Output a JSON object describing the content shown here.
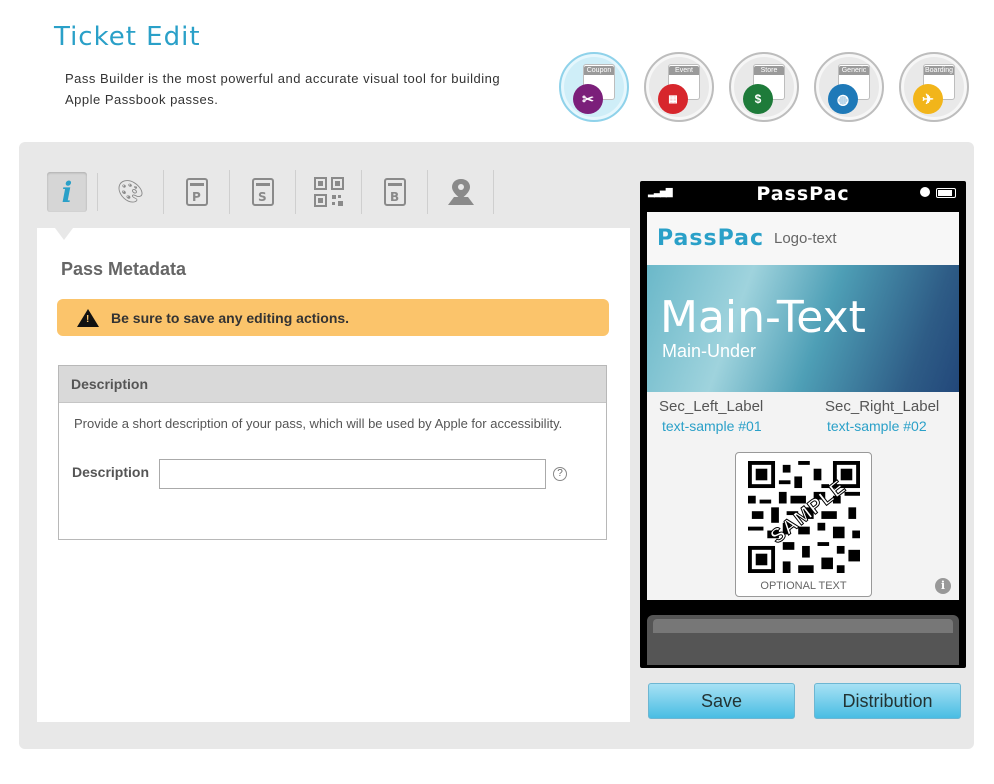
{
  "page": {
    "title": "Ticket Edit",
    "subtitle": "Pass Builder is the most powerful and accurate visual tool for building Apple Passbook passes."
  },
  "pass_types": [
    {
      "label": "Coupon",
      "icon": "scissors-icon",
      "color": "#7b1f7a",
      "active": true
    },
    {
      "label": "Event",
      "icon": "calendar-icon",
      "color": "#d7262c",
      "active": false
    },
    {
      "label": "Store",
      "icon": "dollar-card-icon",
      "color": "#1e7b3a",
      "active": false
    },
    {
      "label": "Generic",
      "icon": "globe-icon",
      "color": "#1e79b8",
      "active": false
    },
    {
      "label": "Boarding",
      "icon": "airplane-icon",
      "color": "#f2b51a",
      "active": false
    }
  ],
  "tabs": [
    {
      "name": "info-tab",
      "icon": "info-icon",
      "active": true
    },
    {
      "name": "design-tab",
      "icon": "palette-icon"
    },
    {
      "name": "primary-fields-tab",
      "icon": "primary-fields-icon"
    },
    {
      "name": "secondary-fields-tab",
      "icon": "secondary-fields-icon"
    },
    {
      "name": "barcode-tab",
      "icon": "qr-code-icon"
    },
    {
      "name": "back-fields-tab",
      "icon": "back-fields-icon"
    },
    {
      "name": "location-tab",
      "icon": "map-pin-icon"
    }
  ],
  "metadata": {
    "section_title": "Pass Metadata",
    "warning": "Be sure to save any editing actions.",
    "description_header": "Description",
    "description_help": "Provide a short description of your pass, which will be used by Apple for accessibility.",
    "description_label": "Description",
    "description_value": "",
    "description_placeholder": "",
    "help_icon": "?"
  },
  "preview": {
    "carrier": "PassPac",
    "logo": "PassPac",
    "logo_text": "Logo-text",
    "main_text": "Main-Text",
    "main_under": "Main-Under",
    "sec_left_label": "Sec_Left_Label",
    "sec_right_label": "Sec_Right_Label",
    "sec_left_value": "text-sample #01",
    "sec_right_value": "text-sample #02",
    "barcode_watermark": "SAMPLE",
    "barcode_text": "OPTIONAL TEXT",
    "info_icon": "i"
  },
  "actions": {
    "save": "Save",
    "distribution": "Distribution"
  },
  "colors": {
    "accent": "#2aa0c8",
    "warning": "#fbc46b",
    "button": "#49bde3"
  }
}
